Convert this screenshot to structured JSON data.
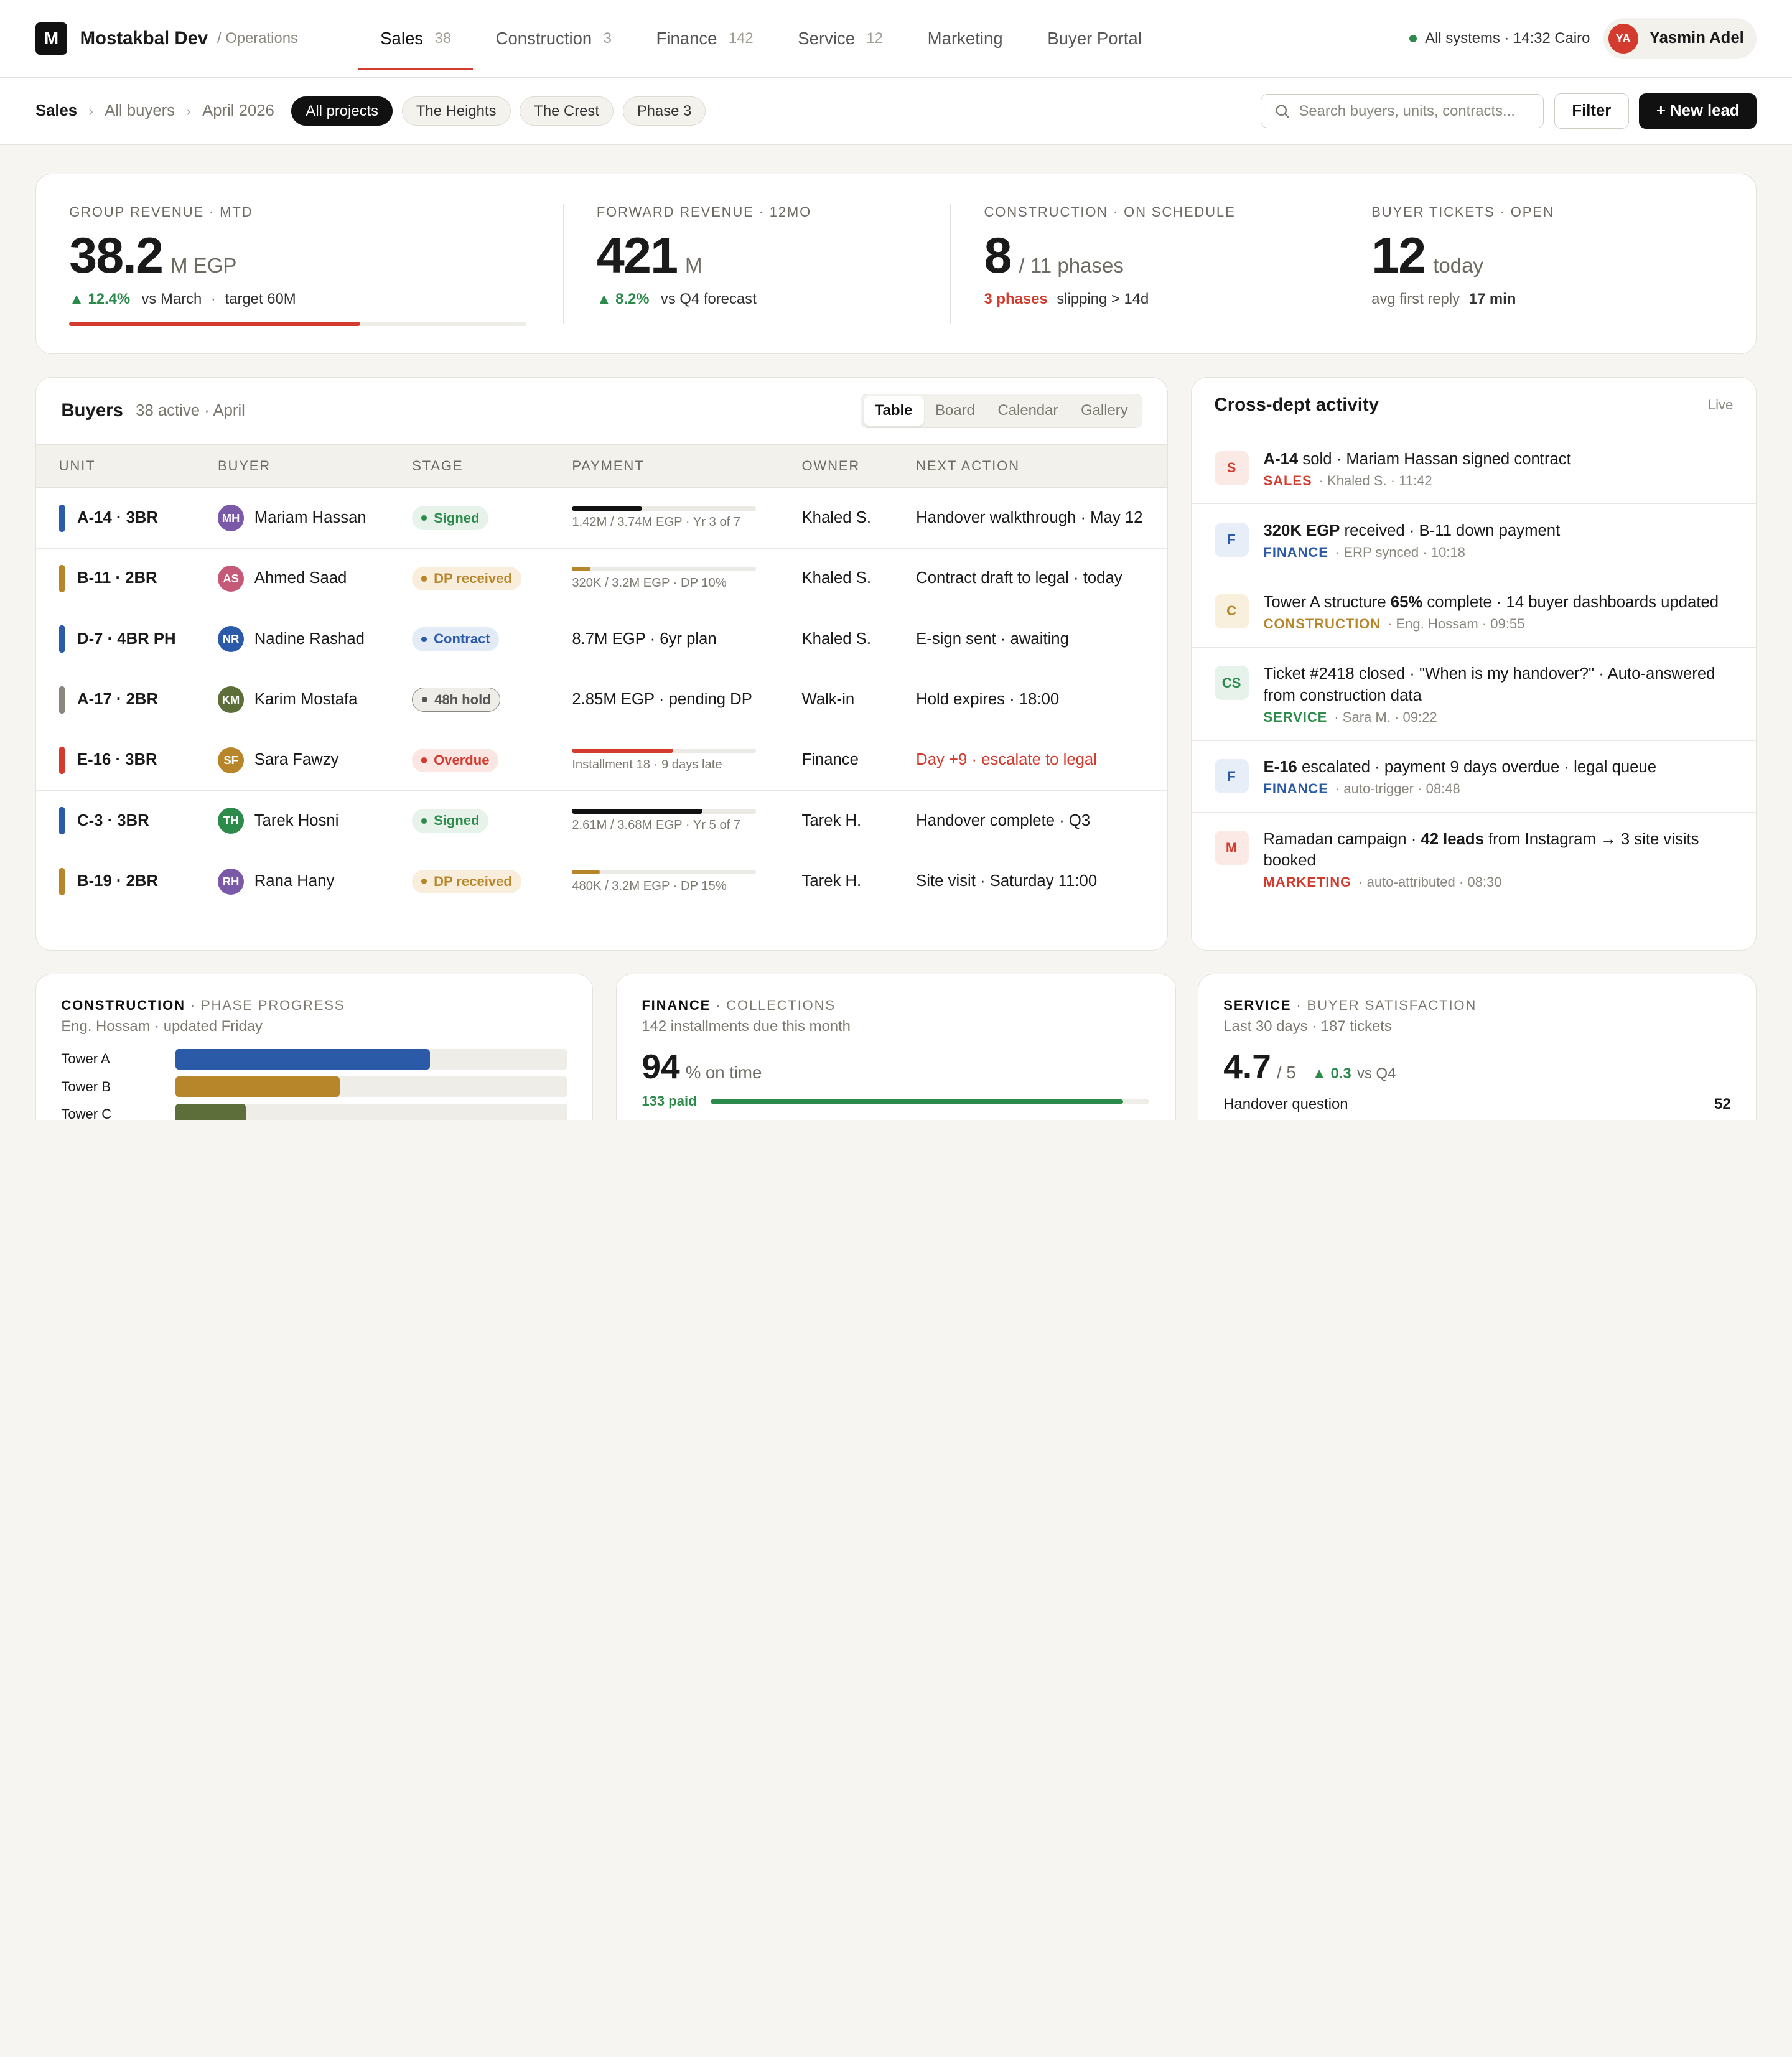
{
  "topbar": {
    "logo_letter": "M",
    "brand": "Mostakbal Dev",
    "brand_sub": "/ Operations",
    "tabs": [
      {
        "label": "Sales",
        "count": "38"
      },
      {
        "label": "Construction",
        "count": "3"
      },
      {
        "label": "Finance",
        "count": "142"
      },
      {
        "label": "Service",
        "count": "12"
      },
      {
        "label": "Marketing",
        "count": ""
      },
      {
        "label": "Buyer Portal",
        "count": ""
      }
    ],
    "status_text": "All systems · 14:32 Cairo",
    "user_initials": "YA",
    "user_name": "Yasmin Adel"
  },
  "subbar": {
    "crumbs": [
      "Sales",
      "All buyers",
      "April 2026"
    ],
    "chips": [
      "All projects",
      "The Heights",
      "The Crest",
      "Phase 3"
    ],
    "search_placeholder": "Search buyers, units, contracts...",
    "filter_label": "Filter",
    "new_lead_label": "+ New lead"
  },
  "kpis": {
    "revenue": {
      "label": "Group revenue · MTD",
      "value": "38.2",
      "unit": "M EGP",
      "delta": "▲ 12.4%",
      "vs": "vs March",
      "sep": "·",
      "target": "target 60M",
      "progress": 0.637
    },
    "forward": {
      "label": "Forward revenue · 12mo",
      "value": "421",
      "unit": "M",
      "delta": "▲ 8.2%",
      "vs": "vs Q4 forecast"
    },
    "construction": {
      "label": "Construction · on schedule",
      "value": "8",
      "unit": "/ 11 phases",
      "alert": "3 phases",
      "note": "slipping > 14d"
    },
    "tickets": {
      "label": "Buyer tickets · open",
      "value": "12",
      "unit": "today",
      "note": "avg first reply",
      "reply": "17 min"
    }
  },
  "buyers": {
    "title": "Buyers",
    "sub": "38 active · April",
    "views": [
      "Table",
      "Board",
      "Calendar",
      "Gallery"
    ],
    "columns": [
      "UNIT",
      "BUYER",
      "STAGE",
      "PAYMENT",
      "OWNER",
      "NEXT ACTION"
    ],
    "rows": [
      {
        "unit": "A-14 · 3BR",
        "unit_color": "#2a5aa8",
        "initials": "MH",
        "av_color": "#7a5aa8",
        "buyer": "Mariam Hassan",
        "stage": "Signed",
        "stage_fg": "#2c8a4a",
        "stage_bg": "#e6f2ea",
        "pay_text": "1.42M / 3.74M EGP · Yr 3 of 7",
        "pay_frac": 0.38,
        "pay_color": "#111",
        "owner": "Khaled S.",
        "next": "Handover walkthrough · May 12",
        "next_red": false
      },
      {
        "unit": "B-11 · 2BR",
        "unit_color": "#b8862a",
        "initials": "AS",
        "av_color": "#c45a78",
        "buyer": "Ahmed Saad",
        "stage": "DP received",
        "stage_fg": "#b8862a",
        "stage_bg": "#f8eedb",
        "pay_text": "320K / 3.2M EGP · DP 10%",
        "pay_frac": 0.1,
        "pay_color": "#b8862a",
        "owner": "Khaled S.",
        "next": "Contract draft to legal · today",
        "next_red": false
      },
      {
        "unit": "D-7 · 4BR PH",
        "unit_color": "#2a5aa8",
        "initials": "NR",
        "av_color": "#2a5aa8",
        "buyer": "Nadine Rashad",
        "stage": "Contract",
        "stage_fg": "#2a5aa8",
        "stage_bg": "#e3ebf7",
        "pay_text": "8.7M EGP · 6yr plan",
        "pay_frac": null,
        "pay_color": "",
        "owner": "Khaled S.",
        "next": "E-sign sent · awaiting",
        "next_red": false
      },
      {
        "unit": "A-17 · 2BR",
        "unit_color": "#8a877f",
        "initials": "KM",
        "av_color": "#5e6e3a",
        "buyer": "Karim Mostafa",
        "stage": "48h hold",
        "stage_fg": "#555",
        "stage_bg": "#efede7",
        "pay_text": "2.85M EGP · pending DP",
        "pay_frac": null,
        "pay_color": "",
        "owner": "Walk-in",
        "next": "Hold expires · 18:00",
        "next_red": false
      },
      {
        "unit": "E-16 · 3BR",
        "unit_color": "#d23b2e",
        "initials": "SF",
        "av_color": "#b8862a",
        "buyer": "Sara Fawzy",
        "stage": "Overdue",
        "stage_fg": "#d23b2e",
        "stage_bg": "#fbe6e3",
        "pay_text": "Installment 18 · 9 days late",
        "pay_frac": 0.55,
        "pay_color": "#d23b2e",
        "owner": "Finance",
        "next": "Day +9 · escalate to legal",
        "next_red": true
      },
      {
        "unit": "C-3 · 3BR",
        "unit_color": "#2a5aa8",
        "initials": "TH",
        "av_color": "#2c8a4a",
        "buyer": "Tarek Hosni",
        "stage": "Signed",
        "stage_fg": "#2c8a4a",
        "stage_bg": "#e6f2ea",
        "pay_text": "2.61M / 3.68M EGP · Yr 5 of 7",
        "pay_frac": 0.71,
        "pay_color": "#111",
        "owner": "Tarek H.",
        "next": "Handover complete · Q3",
        "next_red": false
      },
      {
        "unit": "B-19 · 2BR",
        "unit_color": "#b8862a",
        "initials": "RH",
        "av_color": "#7a5aa8",
        "buyer": "Rana Hany",
        "stage": "DP received",
        "stage_fg": "#b8862a",
        "stage_bg": "#f8eedb",
        "pay_text": "480K / 3.2M EGP · DP 15%",
        "pay_frac": 0.15,
        "pay_color": "#b8862a",
        "owner": "Tarek H.",
        "next": "Site visit · Saturday 11:00",
        "next_red": false
      }
    ]
  },
  "activity": {
    "title": "Cross-dept activity",
    "live": "Live",
    "items": [
      {
        "icon": "S",
        "fg": "#d23b2e",
        "bg": "#fbe9e6",
        "parts": [
          [
            "b",
            "A-14"
          ],
          [
            "t",
            " sold · Mariam Hassan signed contract"
          ]
        ],
        "dept": "SALES",
        "meta": "· Khaled S. · 11:42"
      },
      {
        "icon": "F",
        "fg": "#2a5aa8",
        "bg": "#e7eef8",
        "parts": [
          [
            "b",
            "320K EGP"
          ],
          [
            "t",
            " received · B-11 down payment"
          ]
        ],
        "dept": "FINANCE",
        "meta": "· ERP synced · 10:18"
      },
      {
        "icon": "C",
        "fg": "#b8862a",
        "bg": "#f8efdd",
        "parts": [
          [
            "t",
            "Tower A structure "
          ],
          [
            "b",
            "65%"
          ],
          [
            "t",
            " complete · 14 buyer dashboards updated"
          ]
        ],
        "dept": "CONSTRUCTION",
        "meta": "· Eng. Hossam · 09:55"
      },
      {
        "icon": "CS",
        "fg": "#2c8a4a",
        "bg": "#e6f2ea",
        "parts": [
          [
            "t",
            "Ticket #2418 closed · \"When is my handover?\" · Auto-answered from construction data"
          ]
        ],
        "dept": "SERVICE",
        "meta": "· Sara M. · 09:22"
      },
      {
        "icon": "F",
        "fg": "#2a5aa8",
        "bg": "#e7eef8",
        "parts": [
          [
            "b",
            "E-16"
          ],
          [
            "t",
            " escalated · payment 9 days overdue · legal queue"
          ]
        ],
        "dept": "FINANCE",
        "meta": "· auto-trigger · 08:48"
      },
      {
        "icon": "M",
        "fg": "#d23b2e",
        "bg": "#fbe9e6",
        "parts": [
          [
            "t",
            "Ramadan campaign · "
          ],
          [
            "b",
            "42 leads"
          ],
          [
            "t",
            " from Instagram → 3 site visits booked"
          ]
        ],
        "dept": "MARKETING",
        "meta": "· auto-attributed · 08:30"
      }
    ]
  },
  "construction_card": {
    "label_a": "CONSTRUCTION",
    "label_b": "· PHASE PROGRESS",
    "sub": "Eng. Hossam · updated Friday",
    "phases": [
      {
        "name": "Tower A",
        "pct": 0.65,
        "color": "#2a5aa8"
      },
      {
        "name": "Tower B",
        "pct": 0.42,
        "color": "#b8862a"
      },
      {
        "name": "Tower C",
        "pct": 0.18,
        "color": "#5e6e3a"
      }
    ]
  },
  "finance_card": {
    "label_a": "FINANCE",
    "label_b": "· COLLECTIONS",
    "sub": "142 installments due this month",
    "value": "94",
    "unit": "% on time",
    "paid": "133 paid",
    "paid_frac": 0.94
  },
  "service_card": {
    "label_a": "SERVICE",
    "label_b": "· BUYER SATISFACTION",
    "sub": "Last 30 days · 187 tickets",
    "value": "4.7",
    "unit": "/ 5",
    "delta": "▲ 0.3",
    "vs": "vs Q4",
    "topic": "Handover question",
    "topic_count": "52"
  }
}
